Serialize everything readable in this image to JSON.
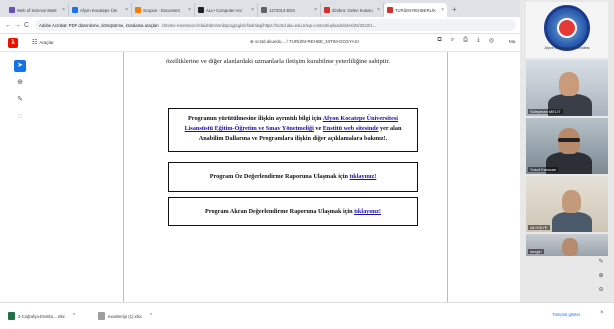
{
  "browser": {
    "tabs": [
      {
        "title": "Web of Science Mast",
        "color": "#6b4fbb"
      },
      {
        "title": "Afyon Kocatepe Üni",
        "color": "#1a73e8"
      },
      {
        "title": "Scopus - Document",
        "color": "#f57c00"
      },
      {
        "title": "ALL• Computer Acc",
        "color": "#202124"
      },
      {
        "title": "1272013 EDS",
        "color": "#5f6368"
      },
      {
        "title": "Zimbra: Gelen Kutusu",
        "color": "#d32f2f"
      },
      {
        "title": "TURİZM-REHBERLİK",
        "color": "#d32f2f",
        "active": true
      }
    ],
    "new_tab_label": "+",
    "nav": {
      "back": "←",
      "forward": "→",
      "reload": "C"
    },
    "url_prefix": "Adobe Acrobat: PDF düzenleme, dönüştürme, imzalama araçları",
    "url": "chrome-extension://efaidnbmnnnibpcajpcglclefindmkaj/https://scstd.aku.edu.tr/wp-content/uploads/sites/25/2022/1..."
  },
  "acrobat": {
    "tools_label": "Araçlar",
    "file_label": "scstd.akuedu... / TURİZM-REHBE_NITIM-DOSYASI",
    "max_label": "Ma"
  },
  "document": {
    "top_line": "özelliklerine ve diğer alanlardaki uzmanlarla iletişim kurabilme yeterliliğine sahiptir.",
    "box1": {
      "t1": "Programın yürütülmesine ilişkin ayrıntılı bilgi için ",
      "link1": "Afyon Kocatepe Üniversitesi Lisansüstü Eğitim-Öğretim ve Sınav Yönetmeliği",
      "t2": " ve ",
      "link2": "Enstitü web sitesinde",
      "t3": " yer alan Anabilim Dallarına ve Programlara ilişkin diğer açıklamalara bakınız!."
    },
    "box2": {
      "text": "Program Öz Değerlendirme Raporuna Ulaşmak için ",
      "link": "tıklayınız!"
    },
    "box3": {
      "text": "Program Akran Değerlendirme Raporuna Ulaşmak için ",
      "link": "tıklayınız!"
    }
  },
  "zoom": {
    "logo_caption": "Afyon Kocatepe Üniversitesi",
    "participants": [
      {
        "name": "Süleyman MELİT"
      },
      {
        "name": "Yusuf Karacan"
      },
      {
        "name": "Ali HİŞYE"
      },
      {
        "name": "sezgin"
      }
    ]
  },
  "downloads": {
    "items": [
      {
        "name": "3-Coğrafya-Enstitü....xlsx",
        "color": "#1e7145"
      },
      {
        "name": "examlerijo (1).xlsx",
        "color": "#9e9e9e"
      }
    ],
    "show_all": "Tümünü göster",
    "close": "×"
  }
}
